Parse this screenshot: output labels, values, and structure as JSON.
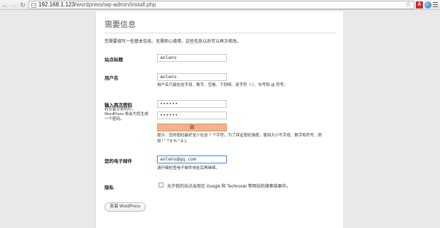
{
  "browser": {
    "url_host": "192.168.1.123",
    "url_path": "/wordpress/wp-admin/install.php",
    "icons": {
      "back": "arrow-left-icon",
      "forward": "arrow-right-icon",
      "reload": "reload-icon",
      "bookmark": "star-icon",
      "extension_1": "adobe-icon",
      "extension_2": "globe-icon",
      "menu": "menu-icon"
    },
    "adobe_glyph": "A"
  },
  "page": {
    "heading": "需要信息",
    "intro": "您需要填写一些基本信息。无需担心填错，这些信息以后可以再次修改。",
    "site_title": {
      "label": "站点标题",
      "value": "aolens"
    },
    "username": {
      "label": "用户名",
      "value": "aolens",
      "help": "用户名只能包含字母、数字、空格、下划线、连字符（-）、句号和 @ 符号。"
    },
    "password": {
      "label": "输入两次密码",
      "sub_lines": [
        "若您留空密码栏，",
        "WordPress 将会为您生成",
        "一个密码。"
      ],
      "value1": "••••••",
      "value2": "••••••",
      "strength": "弱",
      "hint_lines": [
        "提示：您的密码最好至少包含 7 个字符。为了保证密码强度，使用大小写字母、数字和符号，例",
        "如 ! \" ? $ % ^ & )。"
      ]
    },
    "email": {
      "label": "您的电子邮件",
      "value": "aolens@qq.com",
      "help": "请仔细检查电子邮件地址后再继续。"
    },
    "privacy": {
      "label": "隐私",
      "checkbox_label": "允许我的站点出现在 Google 和 Technorati 等网站的搜索结果中。",
      "checked": false
    },
    "submit_label": "安装 WordPress"
  },
  "colors": {
    "strength_weak": "#f5b289",
    "focus_border": "#5b9dd9",
    "page_bg": "#e9e9e9"
  }
}
